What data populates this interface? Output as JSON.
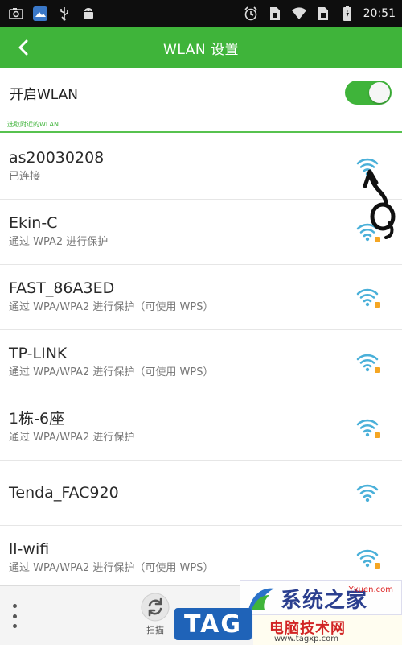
{
  "status_bar": {
    "time": "20:51",
    "left_icons": [
      "screenshot-icon",
      "gallery-icon",
      "usb-icon",
      "android-icon"
    ],
    "right_icons": [
      "alarm-icon",
      "sim-icon",
      "wifi-status-icon",
      "sim2-icon",
      "battery-icon"
    ]
  },
  "app_bar": {
    "title": "WLAN 设置"
  },
  "wlan_toggle": {
    "label": "开启WLAN",
    "enabled": true
  },
  "section": {
    "title": "选取附近的WLAN"
  },
  "networks": [
    {
      "ssid": "as20030208",
      "status": "已连接",
      "secured": false,
      "connected": true
    },
    {
      "ssid": "Ekin-C",
      "status": "通过 WPA2 进行保护",
      "secured": true,
      "connected": false
    },
    {
      "ssid": "FAST_86A3ED",
      "status": "通过 WPA/WPA2 进行保护（可使用 WPS）",
      "secured": true,
      "connected": false
    },
    {
      "ssid": "TP-LINK",
      "status": "通过 WPA/WPA2 进行保护（可使用 WPS）",
      "secured": true,
      "connected": false
    },
    {
      "ssid": "1栋-6座",
      "status": "通过 WPA/WPA2 进行保护",
      "secured": true,
      "connected": false
    },
    {
      "ssid": "Tenda_FAC920",
      "status": "",
      "secured": false,
      "connected": false
    },
    {
      "ssid": "ll-wifi",
      "status": "通过 WPA/WPA2 进行保护（可使用 WPS）",
      "secured": true,
      "connected": false
    }
  ],
  "bottom_bar": {
    "scan_label": "扫描"
  },
  "watermark": {
    "tag": "TAG",
    "logo_text": "系统之家",
    "logo_url": "Yxuen.com",
    "site_name": "电脑技术网",
    "site_url": "www.tagxp.com"
  },
  "colors": {
    "accent": "#3fb43a",
    "wifi_icon": "#4ab0d9",
    "lock": "#f5a623"
  }
}
